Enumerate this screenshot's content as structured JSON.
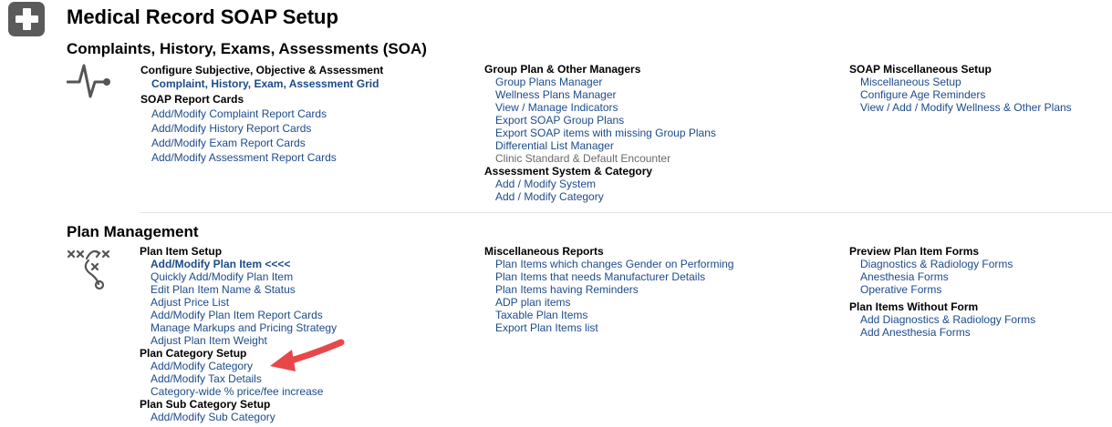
{
  "app": {
    "title": "Medical Record SOAP Setup"
  },
  "sections": {
    "soa": {
      "title": "Complaints, History, Exams, Assessments (SOA)",
      "col1": {
        "group1_heading": "Configure Subjective, Objective & Assessment",
        "group1_links": [
          "Complaint, History, Exam, Assessment Grid"
        ],
        "group2_heading": "SOAP Report Cards",
        "group2_links": [
          "Add/Modify Complaint Report Cards",
          "Add/Modify History Report Cards",
          "Add/Modify Exam Report Cards",
          "Add/Modify Assessment Report Cards"
        ]
      },
      "col2": {
        "group1_heading": "Group Plan & Other Managers",
        "group1_links": [
          "Group Plans Manager",
          "Wellness Plans Manager",
          "View / Manage Indicators",
          "Export SOAP Group Plans",
          "Export SOAP items with missing Group Plans",
          "Differential List Manager",
          "Clinic Standard & Default Encounter"
        ],
        "group2_heading": "Assessment System & Category",
        "group2_links": [
          "Add / Modify System",
          "Add / Modify Category"
        ]
      },
      "col3": {
        "group1_heading": "SOAP Miscellaneous Setup",
        "group1_links": [
          "Miscellaneous Setup",
          "Configure Age Reminders",
          "View / Add / Modify Wellness & Other Plans"
        ]
      }
    },
    "plan": {
      "title": "Plan Management",
      "col1": {
        "group1_heading": "Plan Item Setup",
        "group1_links": [
          "Add/Modify Plan Item <<<<",
          "Quickly Add/Modify Plan Item",
          "Edit Plan Item Name & Status",
          "Adjust Price List",
          "Add/Modify Plan Item Report Cards",
          "Manage Markups and Pricing Strategy",
          "Adjust Plan Item Weight"
        ],
        "group2_heading": "Plan Category Setup",
        "group2_links": [
          "Add/Modify Category",
          "Add/Modify Tax Details",
          "Category-wide % price/fee increase"
        ],
        "group3_heading": "Plan Sub Category Setup",
        "group3_links": [
          "Add/Modify Sub Category"
        ]
      },
      "col2": {
        "group1_heading": "Miscellaneous Reports",
        "group1_links": [
          "Plan Items which changes Gender on Performing",
          "Plan Items that needs Manufacturer Details",
          "Plan Items having Reminders",
          "ADP plan items",
          "Taxable Plan Items",
          "Export Plan Items list"
        ]
      },
      "col3": {
        "group1_heading": "Preview Plan Item Forms",
        "group1_links": [
          "Diagnostics & Radiology Forms",
          "Anesthesia Forms",
          "Operative Forms"
        ],
        "group2_heading": "Plan Items Without Form",
        "group2_links": [
          "Add Diagnostics & Radiology Forms",
          "Add Anesthesia Forms"
        ]
      }
    }
  },
  "icons": {
    "logo": "medical-cross-icon",
    "soa": "heartbeat-icon",
    "plan": "strategy-play-icon",
    "annotation": "red-arrow-icon"
  },
  "colors": {
    "link": "#1c4b8a",
    "annotation_arrow": "#e8474a",
    "logo_bg": "#5a5a5a"
  }
}
